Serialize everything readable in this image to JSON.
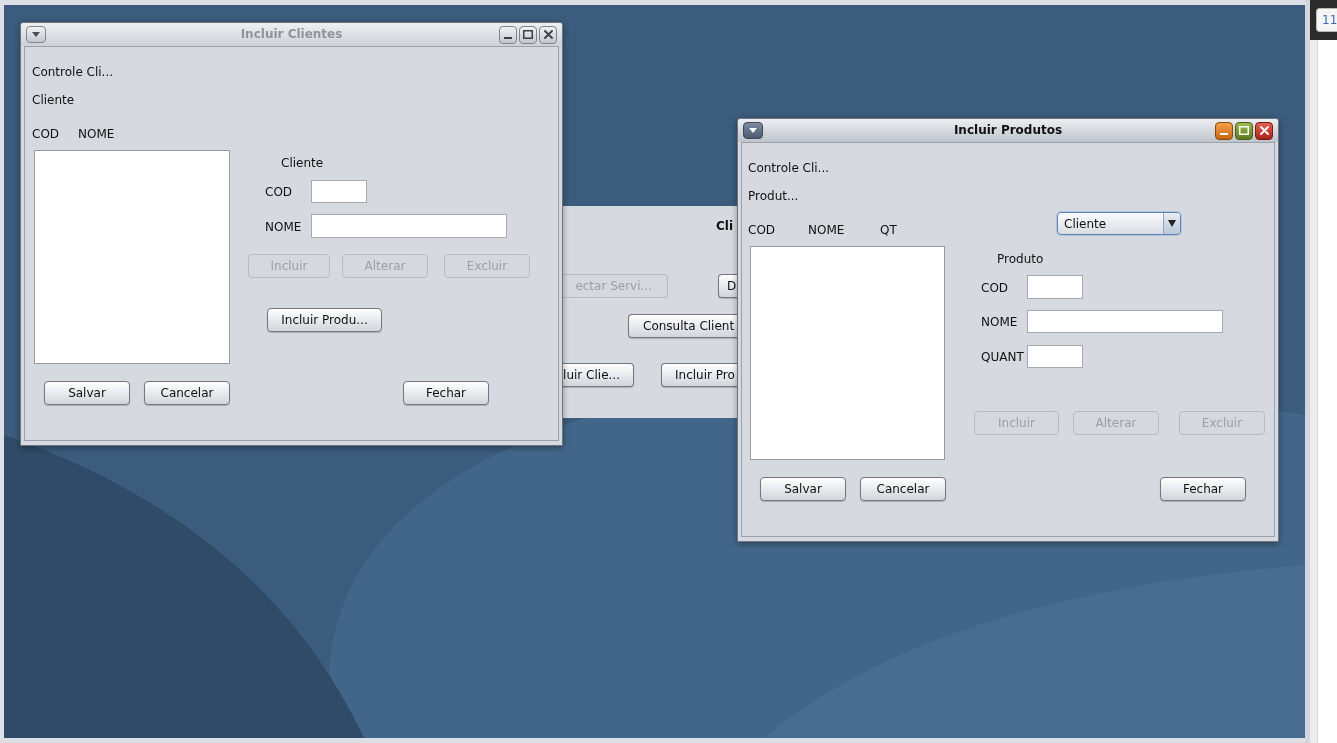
{
  "background_window": {
    "title": "Cli",
    "buttons": [
      {
        "label": "ectar Servi...",
        "disabled": true
      },
      {
        "label": "D",
        "disabled": false
      },
      {
        "label": "Consulta Client",
        "disabled": false
      },
      {
        "label": "luir Clie...",
        "disabled": false
      },
      {
        "label": "Incluir Pro",
        "disabled": false
      }
    ]
  },
  "windows": [
    {
      "title": "Incluir Clientes",
      "active": false,
      "header_labels": [
        "Controle Cli...",
        "Cliente"
      ],
      "list_columns": [
        "COD",
        "NOME"
      ],
      "section_label": "Cliente",
      "fields": [
        {
          "label": "COD"
        },
        {
          "label": "NOME"
        }
      ],
      "action_buttons": [
        {
          "label": "Incluir",
          "disabled": true
        },
        {
          "label": "Alterar",
          "disabled": true
        },
        {
          "label": "Excluir",
          "disabled": true
        }
      ],
      "extra_button": {
        "label": "Incluir Produ...",
        "disabled": false
      },
      "footer_buttons": [
        {
          "label": "Salvar",
          "disabled": false
        },
        {
          "label": "Cancelar",
          "disabled": false
        },
        {
          "label": "Fechar",
          "disabled": false
        }
      ]
    },
    {
      "title": "Incluir Produtos",
      "active": true,
      "header_labels": [
        "Controle Cli...",
        "Produt..."
      ],
      "list_columns": [
        "COD",
        "NOME",
        "QT"
      ],
      "combo": {
        "value": "Cliente"
      },
      "section_label": "Produto",
      "fields": [
        {
          "label": "COD"
        },
        {
          "label": "NOME"
        },
        {
          "label": "QUANT"
        }
      ],
      "action_buttons": [
        {
          "label": "Incluir",
          "disabled": true
        },
        {
          "label": "Alterar",
          "disabled": true
        },
        {
          "label": "Excluir",
          "disabled": true
        }
      ],
      "footer_buttons": [
        {
          "label": "Salvar",
          "disabled": false
        },
        {
          "label": "Cancelar",
          "disabled": false
        },
        {
          "label": "Fechar",
          "disabled": false
        }
      ]
    }
  ],
  "side_panel": {
    "badge": "11"
  }
}
